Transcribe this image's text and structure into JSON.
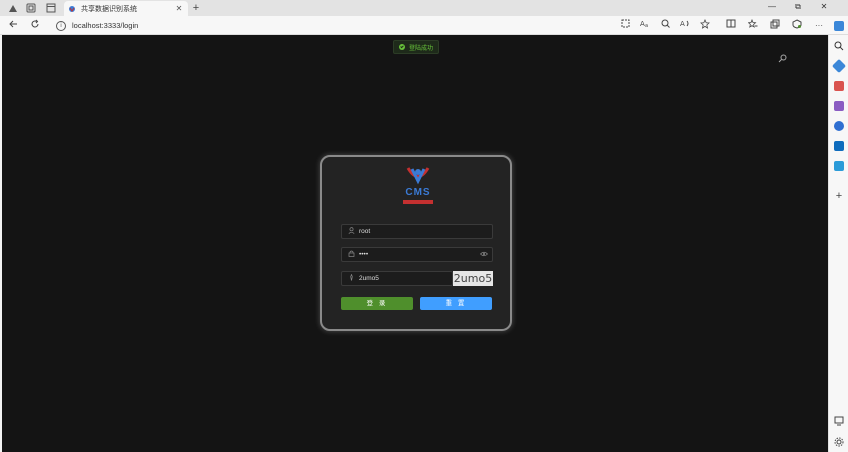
{
  "browser": {
    "tab_title": "共享数据识别系统",
    "url": "localhost:3333/login",
    "close_glyph": "✕",
    "new_tab_glyph": "+",
    "window_controls": {
      "minimize": "—",
      "maximize": "⧉",
      "close": "✕"
    }
  },
  "page": {
    "toast_message": "登陆成功",
    "logo_title": "CMS",
    "logo_subtitle": "",
    "username_value": "root",
    "password_value": "••••",
    "captcha_input_value": "2umo5",
    "captcha_image_text": "2umo5",
    "login_button": "登 录",
    "reset_button": "重 置"
  },
  "colors": {
    "page_bg": "#141414",
    "card_bg": "#232323",
    "login_green": "#4f8f2c",
    "reset_blue": "#409eff",
    "success": "#67c23a"
  }
}
